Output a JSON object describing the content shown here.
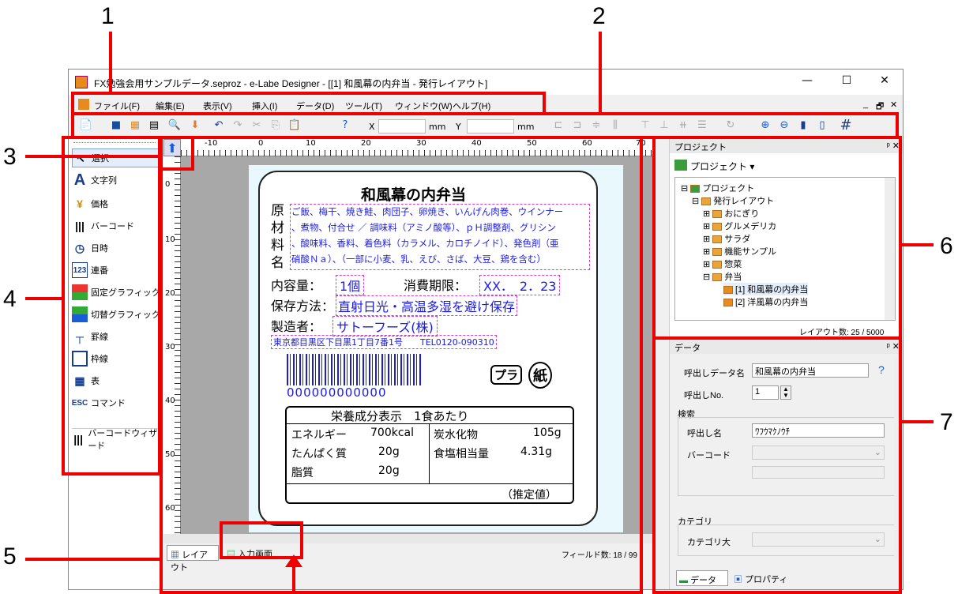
{
  "callouts": [
    "1",
    "2",
    "3",
    "4",
    "5",
    "6",
    "7"
  ],
  "window": {
    "title": "FX勉強会用サンプルデータ.seproz - e-Labe Designer - [[1] 和風幕の内弁当 - 発行レイアウト]",
    "min": "—",
    "max": "☐",
    "close": "✕",
    "mdi_min": "_",
    "mdi_restore": "🗗",
    "mdi_close": "✕"
  },
  "menu": [
    "ファイル(F)",
    "編集(E)",
    "表示(V)",
    "挿入(I)",
    "データ(D)",
    "ツール(T)",
    "ウィンドウ(W)",
    "ヘルプ(H)"
  ],
  "toolbar": {
    "x_label": "X",
    "y_label": "Y",
    "mm1": "mm",
    "mm2": "mm"
  },
  "tools": [
    "選択",
    "文字列",
    "価格",
    "バーコード",
    "日時",
    "連番",
    "固定グラフィック",
    "切替グラフィック",
    "罫線",
    "枠線",
    "表",
    "コマンド",
    "バーコードウィザード"
  ],
  "ruler": {
    "h": [
      "-10",
      "0",
      "10",
      "20",
      "30",
      "40",
      "50",
      "60",
      "70"
    ],
    "v": [
      "0",
      "10",
      "20",
      "30",
      "40",
      "50",
      "60"
    ]
  },
  "label": {
    "title": "和風幕の内弁当",
    "genzai_label": "原材料名",
    "genzai": [
      "ご飯、梅干、焼き鮭、肉団子、卵焼き、いんげん肉巻、ウインナー",
      "、煮物、付合せ ／ 調味料（アミノ酸等）、ｐＨ調整剤、グリシン",
      "、酸味料、香料、着色料（カラメル、カロチノイド）、発色剤（亜",
      "硝酸Ｎａ）、（一部に小麦、乳、えび、さば、大豆、鶏を含む）"
    ],
    "naiyo_label": "内容量：",
    "naiyo": "1個",
    "kigen_label": "消費期限：",
    "kigen": "XX．　2．23",
    "hozon_label": "保存方法：",
    "hozon": "直射日光・高温多湿を避け保存",
    "seizo_label": "製造者：",
    "seizo": "サトーフーズ(株)",
    "address": "東京都目黒区下目黒1丁目7番1号　　TEL0120-090310",
    "barcode_num": "000000000000",
    "recycle1": "プラ",
    "recycle2": "紙",
    "nutri_title": "栄養成分表示　1食あたり",
    "nutri": [
      {
        "k": "エネルギー",
        "v": "700kcal"
      },
      {
        "k": "たんぱく質",
        "v": "20g"
      },
      {
        "k": "脂質",
        "v": "20g"
      }
    ],
    "nutri2": [
      {
        "k": "炭水化物",
        "v": "105g"
      },
      {
        "k": "食塩相当量",
        "v": "4.31g"
      }
    ],
    "suitei": "（推定値）"
  },
  "bottom": {
    "tab1": "レイアウト",
    "tab2": "入力画面",
    "fields": "フィールド数: 18 / 99"
  },
  "project": {
    "header": "プロジェクト",
    "pin": "ᵖ ✕",
    "dropdown": "プロジェクト ▾",
    "tree": [
      "プロジェクト",
      "発行レイアウト",
      "おにぎり",
      "グルメデリカ",
      "サラダ",
      "機能サンプル",
      "惣菜",
      "弁当",
      "[1] 和風幕の内弁当",
      "[2] 洋風幕の内弁当"
    ],
    "count": "レイアウト数: 25 / 5000"
  },
  "data": {
    "header": "データ",
    "pin": "ᵖ ✕",
    "name_label": "呼出しデータ名",
    "name_value": "和風幕の内弁当",
    "no_label": "呼出しNo.",
    "no_value": "1",
    "search_label": "検索",
    "yobi_label": "呼出し名",
    "yobi_value": "ﾜﾌｳﾏｸﾉｳﾁ",
    "barcode_label": "バーコード",
    "category_label": "カテゴリ",
    "category_big": "カテゴリ大",
    "tab_data": "データ",
    "tab_prop": "プロパティ"
  },
  "colors": {
    "accent_red": "#e00000",
    "label_blue": "#1a1ae8"
  }
}
